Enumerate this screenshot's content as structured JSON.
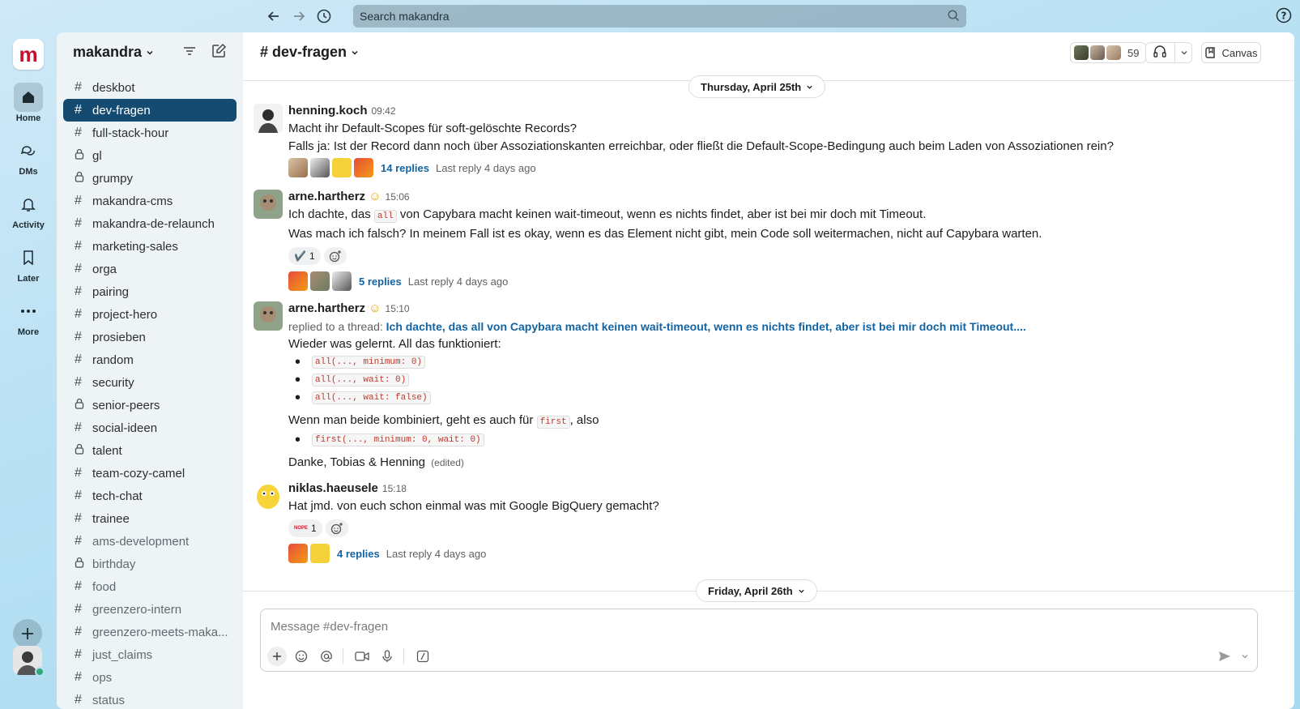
{
  "search": {
    "placeholder": "Search makandra"
  },
  "rail": {
    "logo": "m",
    "items": [
      {
        "label": "Home"
      },
      {
        "label": "DMs"
      },
      {
        "label": "Activity"
      },
      {
        "label": "Later"
      },
      {
        "label": "More"
      }
    ]
  },
  "sidebar": {
    "workspace_name": "makandra",
    "channels": [
      {
        "name": "deskbot",
        "type": "hash"
      },
      {
        "name": "dev-fragen",
        "type": "hash",
        "active": true
      },
      {
        "name": "full-stack-hour",
        "type": "hash"
      },
      {
        "name": "gl",
        "type": "lock"
      },
      {
        "name": "grumpy",
        "type": "lock"
      },
      {
        "name": "makandra-cms",
        "type": "hash"
      },
      {
        "name": "makandra-de-relaunch",
        "type": "hash"
      },
      {
        "name": "marketing-sales",
        "type": "hash"
      },
      {
        "name": "orga",
        "type": "hash"
      },
      {
        "name": "pairing",
        "type": "hash"
      },
      {
        "name": "project-hero",
        "type": "hash"
      },
      {
        "name": "prosieben",
        "type": "hash"
      },
      {
        "name": "random",
        "type": "hash"
      },
      {
        "name": "security",
        "type": "hash"
      },
      {
        "name": "senior-peers",
        "type": "lock"
      },
      {
        "name": "social-ideen",
        "type": "hash"
      },
      {
        "name": "talent",
        "type": "lock"
      },
      {
        "name": "team-cozy-camel",
        "type": "hash"
      },
      {
        "name": "tech-chat",
        "type": "hash"
      },
      {
        "name": "trainee",
        "type": "hash"
      },
      {
        "name": "ams-development",
        "type": "hash",
        "muted": true
      },
      {
        "name": "birthday",
        "type": "lock",
        "muted": true
      },
      {
        "name": "food",
        "type": "hash",
        "muted": true
      },
      {
        "name": "greenzero-intern",
        "type": "hash",
        "muted": true
      },
      {
        "name": "greenzero-meets-maka...",
        "type": "hash",
        "muted": true
      },
      {
        "name": "just_claims",
        "type": "hash",
        "muted": true
      },
      {
        "name": "ops",
        "type": "hash",
        "muted": true
      },
      {
        "name": "status",
        "type": "hash",
        "muted": true
      }
    ]
  },
  "channel": {
    "title": "# dev-fragen",
    "member_count": "59",
    "canvas_label": "Canvas"
  },
  "dates": {
    "first": "Thursday, April 25th",
    "second": "Friday, April 26th"
  },
  "messages": {
    "m1": {
      "author": "henning.koch",
      "time": "09:42",
      "line1": "Macht ihr Default-Scopes für soft-gelöschte Records?",
      "line2": "Falls ja: Ist der Record dann noch über Assoziationskanten erreichbar, oder fließt die Default-Scope-Bedingung auch beim Laden von Assoziationen rein?",
      "replies": "14 replies",
      "last_reply": "Last reply 4 days ago"
    },
    "m2": {
      "author": "arne.hartherz",
      "status_emoji": "☺",
      "time": "15:06",
      "line1_pre": "Ich dachte, das",
      "line1_code": "all",
      "line1_post": "von Capybara macht keinen wait-timeout, wenn es nichts findet, aber ist bei mir doch mit Timeout.",
      "line2": "Was mach ich falsch? In meinem Fall ist es okay, wenn es das Element nicht gibt, mein Code soll weitermachen, nicht auf Capybara warten.",
      "reaction_emoji": "✔️",
      "reaction_count": "1",
      "replies": "5 replies",
      "last_reply": "Last reply 4 days ago"
    },
    "m3": {
      "author": "arne.hartherz",
      "status_emoji": "☺",
      "time": "15:10",
      "replied_prefix": "replied to a thread:",
      "replied_link": "Ich dachte, das all von Capybara macht keinen wait-timeout, wenn es nichts findet, aber ist bei mir doch mit Timeout....",
      "line1": "Wieder was gelernt. All das funktioniert:",
      "bullets": [
        "all(..., minimum: 0)",
        "all(..., wait: 0)",
        "all(..., wait: false)"
      ],
      "line2_pre": "Wenn man beide kombiniert, geht es auch für",
      "line2_code": "first",
      "line2_post": ", also",
      "bullet2": "first(..., minimum: 0, wait: 0)",
      "line3": "Danke, Tobias & Henning",
      "edited": "(edited)"
    },
    "m4": {
      "author": "niklas.haeusele",
      "time": "15:18",
      "line1": "Hat jmd. von euch schon einmal was mit Google BigQuery gemacht?",
      "reaction_emoji": "NOPE",
      "reaction_count": "1",
      "replies": "4 replies",
      "last_reply": "Last reply 4 days ago"
    }
  },
  "composer": {
    "placeholder": "Message #dev-fragen"
  },
  "colors": {
    "active_channel": "#154b70",
    "link": "#1264a3",
    "code": "#c0392b",
    "presence": "#2bac76",
    "brand": "#c8102e"
  }
}
